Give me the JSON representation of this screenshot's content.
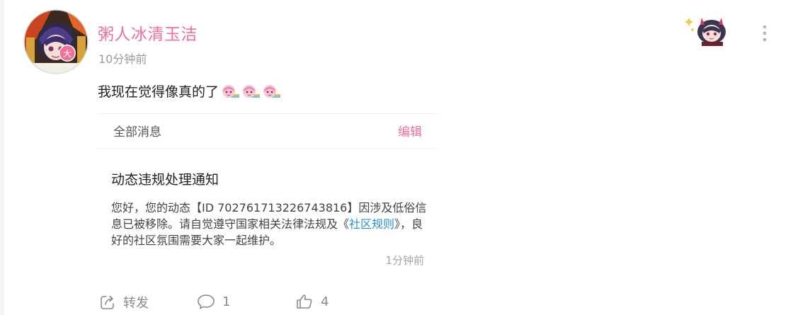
{
  "post": {
    "username": "粥人冰清玉洁",
    "time": "10分钟前",
    "text": "我现在觉得像真的了",
    "sticker_icons": [
      "pink-chibi-sticker",
      "pink-chibi-sticker",
      "pink-chibi-sticker"
    ]
  },
  "embed": {
    "all_messages_label": "全部消息",
    "edit_label": "编辑",
    "notice_title": "动态违规处理通知",
    "notice_body_prefix": "您好，您的动态【ID 702761713226743816】因涉及低俗信息已被移除。请自觉遵守国家相关法律法规及《",
    "notice_link": "社区规则",
    "notice_body_suffix": "》，良好的社区氛围需要大家一起维护。",
    "notice_time": "1分钟前"
  },
  "actions": {
    "forward_label": "转发",
    "comment_count": "1",
    "like_count": "4"
  },
  "icons": {
    "more": "more-vertical-icon",
    "forward": "forward-icon",
    "comment": "comment-icon",
    "like": "thumbs-up-icon"
  },
  "colors": {
    "accent_pink": "#f07098",
    "link_blue": "#2a8fd0",
    "muted_gray": "#9a9a9a"
  }
}
